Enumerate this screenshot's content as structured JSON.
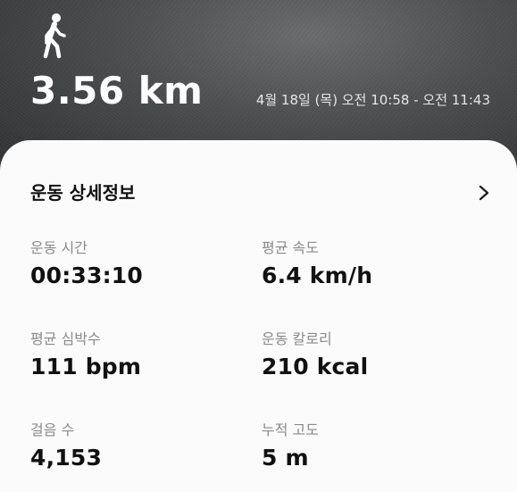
{
  "header": {
    "activity_icon": "walking-person-icon",
    "distance": "3.56 km",
    "time_range": "4월 18일 (목) 오전 10:58 - 오전 11:43"
  },
  "details": {
    "title": "운동 상세정보",
    "chevron_icon": "chevron-right-icon",
    "metrics": [
      {
        "label": "운동 시간",
        "value": "00:33:10"
      },
      {
        "label": "평균 속도",
        "value": "6.4 km/h"
      },
      {
        "label": "평균 심박수",
        "value": "111 bpm"
      },
      {
        "label": "운동 칼로리",
        "value": "210 kcal"
      },
      {
        "label": "걸음 수",
        "value": "4,153"
      },
      {
        "label": "누적 고도",
        "value": "5 m"
      }
    ]
  },
  "colors": {
    "card_background": "#fbfbfc",
    "label_gray": "#8a8a8a",
    "value_text": "#111111",
    "hero_text": "#ffffff"
  }
}
